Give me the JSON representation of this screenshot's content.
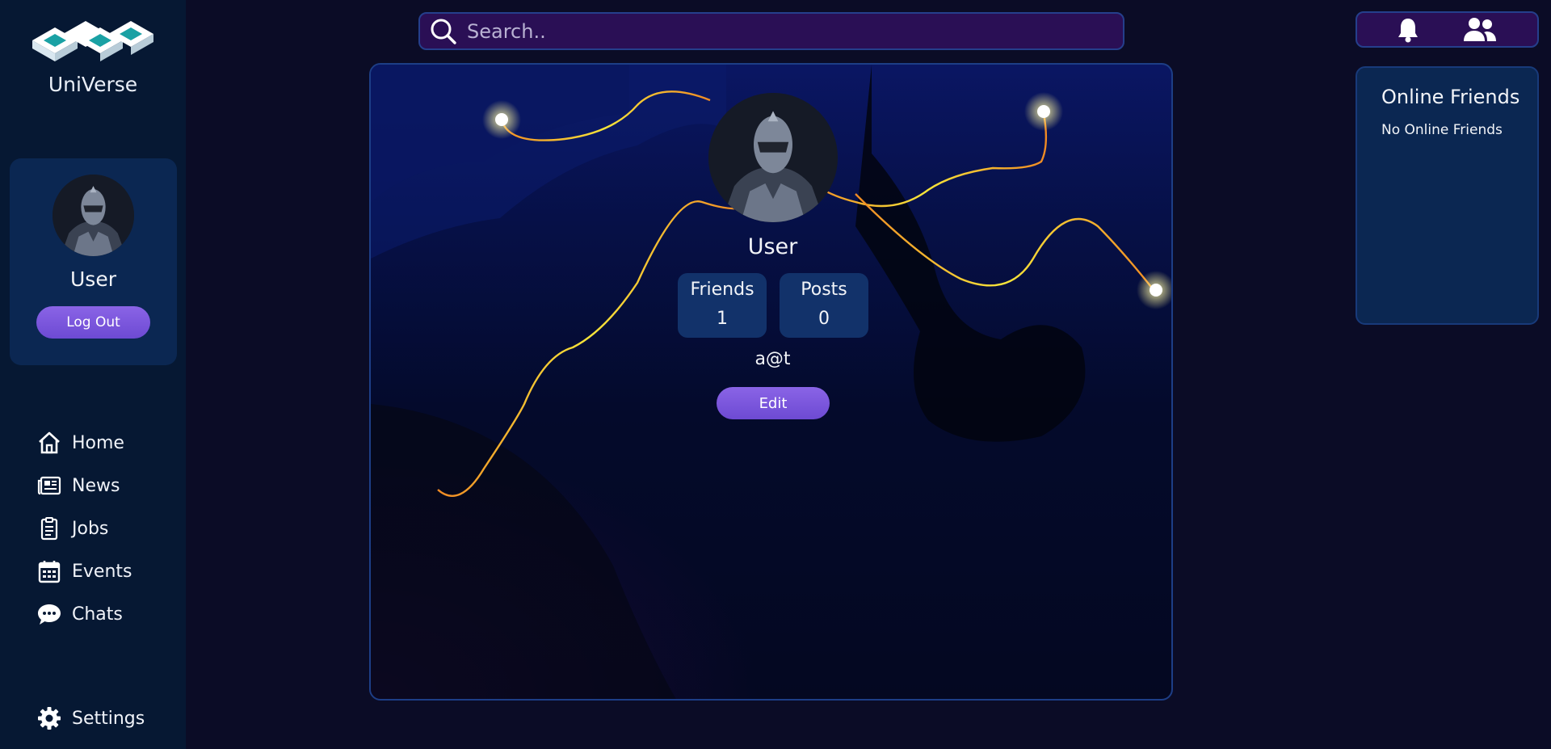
{
  "app": {
    "name": "UniVerse"
  },
  "sidebar": {
    "user": {
      "name": "User",
      "logout_label": "Log Out"
    },
    "nav": [
      {
        "label": "Home",
        "icon": "home-icon"
      },
      {
        "label": "News",
        "icon": "newspaper-icon"
      },
      {
        "label": "Jobs",
        "icon": "clipboard-icon"
      },
      {
        "label": "Events",
        "icon": "calendar-icon"
      },
      {
        "label": "Chats",
        "icon": "chat-icon"
      }
    ],
    "settings_label": "Settings"
  },
  "search": {
    "placeholder": "Search.."
  },
  "top_icons": [
    "bell-icon",
    "friends-icon"
  ],
  "online_friends": {
    "title": "Online Friends",
    "empty_text": "No Online Friends"
  },
  "profile": {
    "name": "User",
    "stats": [
      {
        "label": "Friends",
        "value": "1"
      },
      {
        "label": "Posts",
        "value": "0"
      }
    ],
    "email": "a@t",
    "edit_label": "Edit"
  },
  "colors": {
    "sidebar_bg": "#061833",
    "card_bg": "#0b2752",
    "accent_purple": "#7a56dd",
    "search_bg": "#2a0f55",
    "glow_yellow": "#f7e53a",
    "glow_orange": "#f08a24"
  }
}
